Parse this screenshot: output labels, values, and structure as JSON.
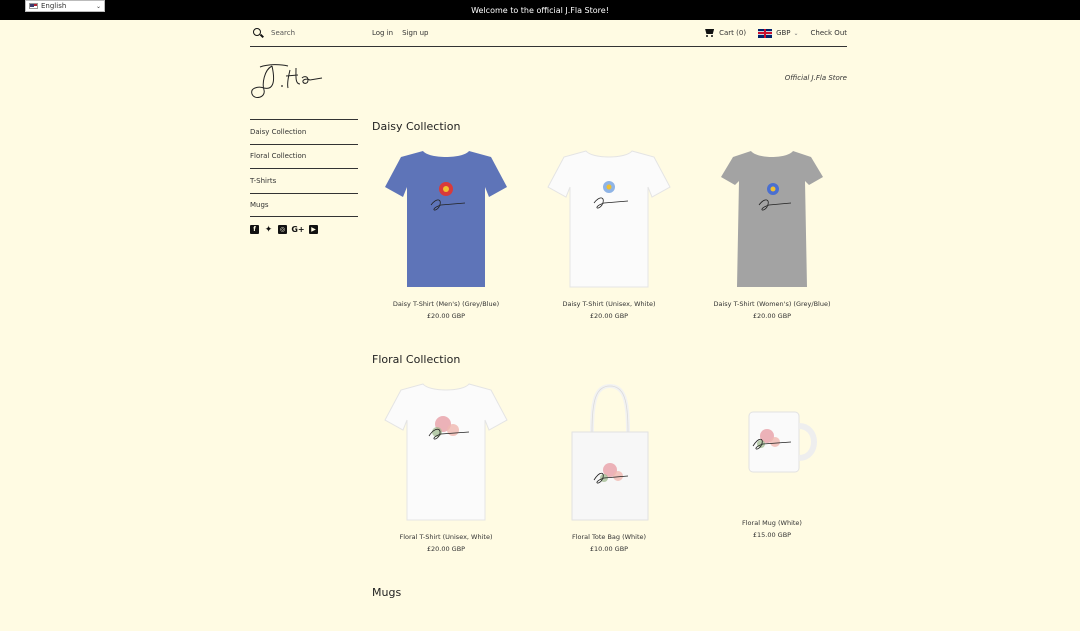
{
  "topbar": {
    "message": "Welcome to the official J.Fla Store!"
  },
  "language_select": {
    "value": "English"
  },
  "header": {
    "search_placeholder": "Search",
    "login": "Log in",
    "signup": "Sign up",
    "cart": "Cart (0)",
    "currency": "GBP",
    "checkout": "Check Out"
  },
  "tagline": "Official J.Fla Store",
  "sidebar": {
    "items": [
      {
        "label": "Daisy Collection"
      },
      {
        "label": "Floral Collection"
      },
      {
        "label": "T-Shirts"
      },
      {
        "label": "Mugs"
      }
    ]
  },
  "social_icons": [
    "facebook-icon",
    "twitter-icon",
    "instagram-icon",
    "google-plus-icon",
    "youtube-icon"
  ],
  "sections": [
    {
      "title": "Daisy Collection",
      "products": [
        {
          "name": "Daisy T-Shirt (Men's) (Grey/Blue)",
          "price": "£20.00 GBP"
        },
        {
          "name": "Daisy T-Shirt (Unisex, White)",
          "price": "£20.00 GBP"
        },
        {
          "name": "Daisy T-Shirt (Women's) (Grey/Blue)",
          "price": "£20.00 GBP"
        }
      ]
    },
    {
      "title": "Floral Collection",
      "products": [
        {
          "name": "Floral T-Shirt (Unisex, White)",
          "price": "£20.00 GBP"
        },
        {
          "name": "Floral Tote Bag (White)",
          "price": "£10.00 GBP"
        },
        {
          "name": "Floral Mug (White)",
          "price": "£15.00 GBP"
        }
      ]
    },
    {
      "title": "Mugs"
    }
  ],
  "colors": {
    "page_bg": "#fffbe3",
    "topbar_bg": "#000000",
    "shirt_blue": "#5e74b8",
    "shirt_grey": "#a3a3a3"
  }
}
